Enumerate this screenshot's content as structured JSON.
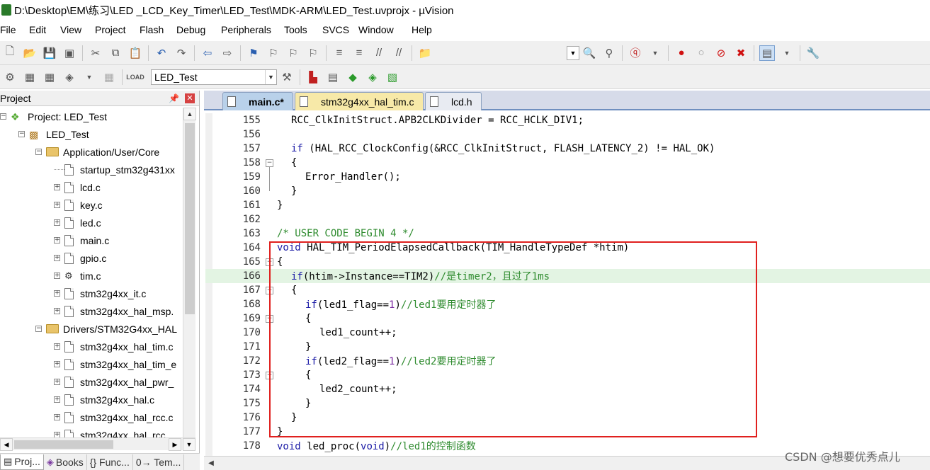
{
  "window": {
    "title": "D:\\Desktop\\EM\\练习\\LED _LCD_Key_Timer\\LED_Test\\MDK-ARM\\LED_Test.uvprojx - µVision"
  },
  "menu": [
    "File",
    "Edit",
    "View",
    "Project",
    "Flash",
    "Debug",
    "Peripherals",
    "Tools",
    "SVCS",
    "Window",
    "Help"
  ],
  "toolbar": {
    "target_name": "LED_Test"
  },
  "project_panel": {
    "title": "Project",
    "tree": [
      {
        "label": "Project: LED_Test",
        "level": 0,
        "type": "project",
        "expander": "−"
      },
      {
        "label": "LED_Test",
        "level": 1,
        "type": "target",
        "expander": "−"
      },
      {
        "label": "Application/User/Core",
        "level": 2,
        "type": "folder",
        "expander": "−"
      },
      {
        "label": "startup_stm32g431xx",
        "level": 3,
        "type": "file",
        "expander": ""
      },
      {
        "label": "lcd.c",
        "level": 3,
        "type": "file",
        "expander": "+"
      },
      {
        "label": "key.c",
        "level": 3,
        "type": "file",
        "expander": "+"
      },
      {
        "label": "led.c",
        "level": 3,
        "type": "file",
        "expander": "+"
      },
      {
        "label": "main.c",
        "level": 3,
        "type": "file",
        "expander": "+"
      },
      {
        "label": "gpio.c",
        "level": 3,
        "type": "file",
        "expander": "+"
      },
      {
        "label": "tim.c",
        "level": 3,
        "type": "gearfile",
        "expander": "+"
      },
      {
        "label": "stm32g4xx_it.c",
        "level": 3,
        "type": "file",
        "expander": "+"
      },
      {
        "label": "stm32g4xx_hal_msp.",
        "level": 3,
        "type": "file",
        "expander": "+"
      },
      {
        "label": "Drivers/STM32G4xx_HAL",
        "level": 2,
        "type": "folder",
        "expander": "−"
      },
      {
        "label": "stm32g4xx_hal_tim.c",
        "level": 3,
        "type": "file",
        "expander": "+"
      },
      {
        "label": "stm32g4xx_hal_tim_e",
        "level": 3,
        "type": "file",
        "expander": "+"
      },
      {
        "label": "stm32g4xx_hal_pwr_",
        "level": 3,
        "type": "file",
        "expander": "+"
      },
      {
        "label": "stm32g4xx_hal.c",
        "level": 3,
        "type": "file",
        "expander": "+"
      },
      {
        "label": "stm32g4xx_hal_rcc.c",
        "level": 3,
        "type": "file",
        "expander": "+"
      },
      {
        "label": "stm32g4xx_hal_rcc_",
        "level": 3,
        "type": "file",
        "expander": "+"
      }
    ],
    "bottom_tabs": [
      "Proj...",
      "Books",
      "{} Func...",
      "0→ Tem..."
    ]
  },
  "editor": {
    "tabs": [
      {
        "label": "main.c*",
        "active": true
      },
      {
        "label": "stm32g4xx_hal_tim.c",
        "active": false
      },
      {
        "label": "lcd.h",
        "active": false
      }
    ],
    "lines": [
      {
        "num": "155",
        "code": "RCC_ClkInitStruct.APB2CLKDivider = RCC_HCLK_DIV1;",
        "indent": 1,
        "fold": ""
      },
      {
        "num": "156",
        "code": "",
        "indent": 1,
        "fold": ""
      },
      {
        "num": "157",
        "code": "if (HAL_RCC_ClockConfig(&RCC_ClkInitStruct, FLASH_LATENCY_2) != HAL_OK)",
        "indent": 1,
        "fold": ""
      },
      {
        "num": "158",
        "code": "{",
        "indent": 1,
        "fold": "−"
      },
      {
        "num": "159",
        "code": "Error_Handler();",
        "indent": 2,
        "fold": ""
      },
      {
        "num": "160",
        "code": "}",
        "indent": 1,
        "fold": ""
      },
      {
        "num": "161",
        "code": "}",
        "indent": 0,
        "fold": ""
      },
      {
        "num": "162",
        "code": "",
        "indent": 0,
        "fold": ""
      },
      {
        "num": "163",
        "code": "/* USER CODE BEGIN 4 */",
        "indent": 0,
        "fold": ""
      },
      {
        "num": "164",
        "code": "void HAL_TIM_PeriodElapsedCallback(TIM_HandleTypeDef *htim)",
        "indent": 0,
        "fold": ""
      },
      {
        "num": "165",
        "code": "{",
        "indent": 0,
        "fold": "−"
      },
      {
        "num": "166",
        "code": "if(htim->Instance==TIM2)//是timer2，且过了1ms",
        "indent": 1,
        "fold": ""
      },
      {
        "num": "167",
        "code": "{",
        "indent": 1,
        "fold": "−"
      },
      {
        "num": "168",
        "code": "if(led1_flag==1)//led1要用定时器了",
        "indent": 2,
        "fold": ""
      },
      {
        "num": "169",
        "code": "{",
        "indent": 2,
        "fold": "−"
      },
      {
        "num": "170",
        "code": "led1_count++;",
        "indent": 3,
        "fold": ""
      },
      {
        "num": "171",
        "code": "}",
        "indent": 2,
        "fold": ""
      },
      {
        "num": "172",
        "code": "if(led2_flag==1)//led2要用定时器了",
        "indent": 2,
        "fold": ""
      },
      {
        "num": "173",
        "code": "{",
        "indent": 2,
        "fold": "−"
      },
      {
        "num": "174",
        "code": "led2_count++;",
        "indent": 3,
        "fold": ""
      },
      {
        "num": "175",
        "code": "}",
        "indent": 2,
        "fold": ""
      },
      {
        "num": "176",
        "code": "}",
        "indent": 1,
        "fold": ""
      },
      {
        "num": "177",
        "code": "}",
        "indent": 0,
        "fold": ""
      },
      {
        "num": "178",
        "code": "void led_proc(void)//led1的控制函数",
        "indent": 0,
        "fold": ""
      }
    ],
    "highlighted_line": "166"
  },
  "watermark": "CSDN @想要优秀点儿",
  "colors": {
    "keyword": "#1a1aa6",
    "comment": "#2e8b2e",
    "number": "#7a2aa0",
    "highlight_box": "#e0201e",
    "current_line": "#e3f4e3"
  }
}
